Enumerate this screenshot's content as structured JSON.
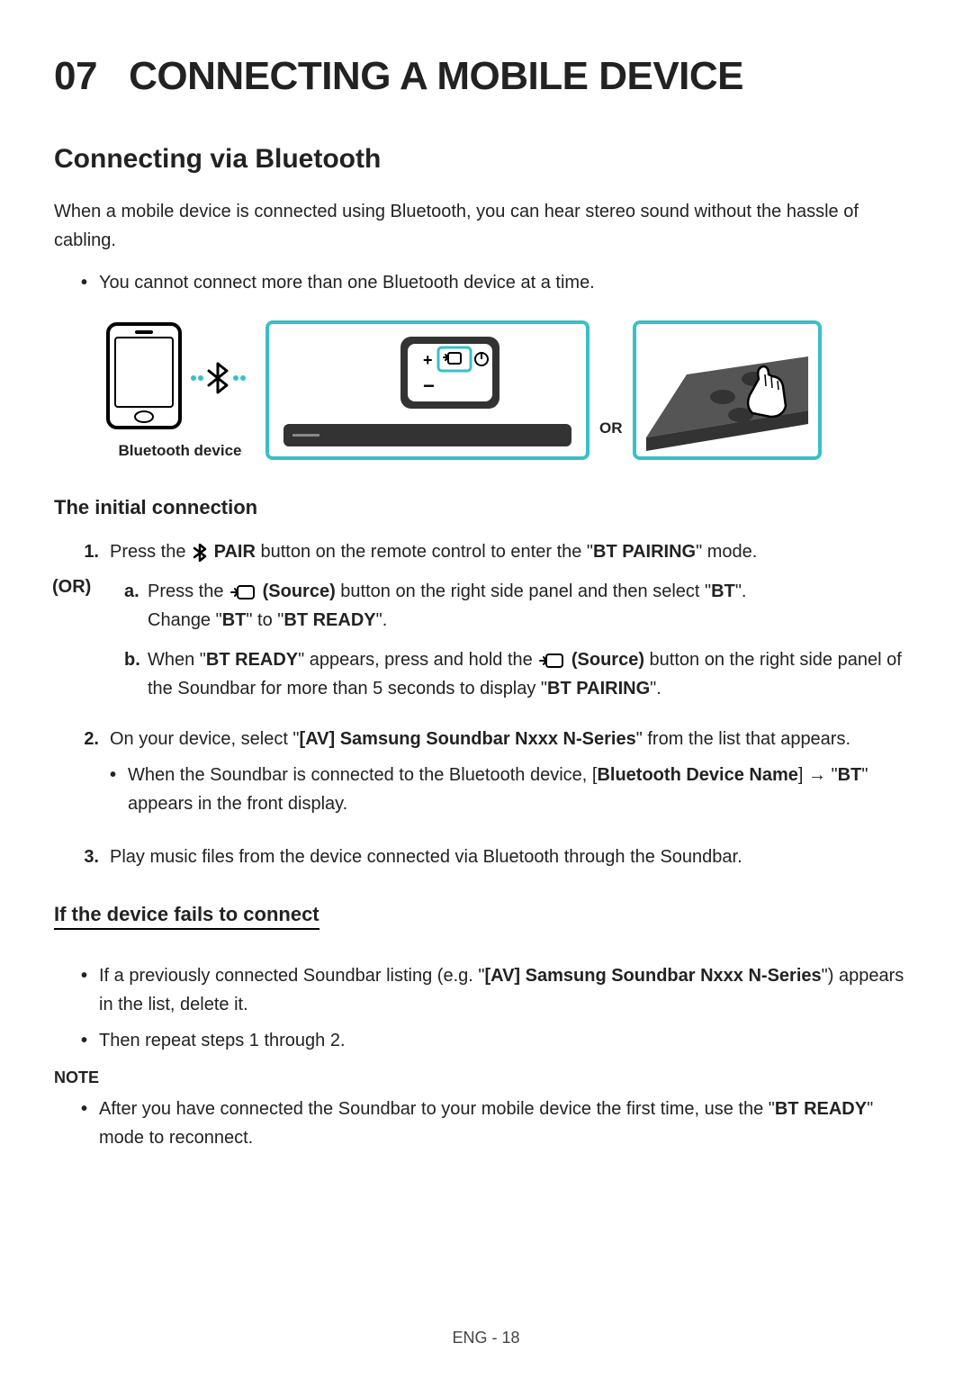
{
  "chapter": {
    "number": "07",
    "title": "CONNECTING A MOBILE DEVICE"
  },
  "section_title": "Connecting via Bluetooth",
  "intro": "When a mobile device is connected using Bluetooth, you can hear stereo sound without the hassle of cabling.",
  "intro_bullet": "You cannot connect more than one Bluetooth device at a time.",
  "figure": {
    "caption": "Bluetooth device",
    "or_label": "OR"
  },
  "sub_initial": "The initial connection",
  "step1": {
    "num": "1.",
    "pre": "Press the ",
    "pair_label": "PAIR",
    "mid": " button on the remote control to enter the \"",
    "bt_pairing": "BT PAIRING",
    "end": "\" mode."
  },
  "or_label": "(OR)",
  "step_a": {
    "letter": "a.",
    "pre": "Press the ",
    "source_label": "(Source)",
    "mid": " button on the right side panel and then select \"",
    "bt": "BT",
    "end": "\".",
    "line2_pre": "Change \"",
    "line2_bt": "BT",
    "line2_mid": "\" to \"",
    "line2_ready": "BT READY",
    "line2_end": "\"."
  },
  "step_b": {
    "letter": "b.",
    "pre": "When \"",
    "bt_ready": "BT READY",
    "mid": "\" appears, press and hold the ",
    "source_label": "(Source)",
    "mid2": " button on the right side panel of the Soundbar for more than 5 seconds to display \"",
    "bt_pairing": "BT PAIRING",
    "end": "\"."
  },
  "step2": {
    "num": "2.",
    "pre": "On your device, select \"",
    "device_name": "[AV] Samsung Soundbar Nxxx N-Series",
    "end": "\" from the list that appears.",
    "bullet_pre": "When the Soundbar is connected to the Bluetooth device, [",
    "bullet_bold": "Bluetooth Device Name",
    "bullet_mid": "] → \"",
    "bullet_bt": "BT",
    "bullet_end": "\" appears in the front display."
  },
  "step3": {
    "num": "3.",
    "text": "Play music files from the device connected via Bluetooth through the Soundbar."
  },
  "sub_fails": "If the device fails to connect",
  "fail_bullet1_pre": "If a previously connected Soundbar listing (e.g. \"",
  "fail_bullet1_bold": "[AV] Samsung Soundbar Nxxx N-Series",
  "fail_bullet1_end": "\") appears in the list, delete it.",
  "fail_bullet2": "Then repeat steps 1 through 2.",
  "note_label": "NOTE",
  "note_bullet_pre": "After you have connected the Soundbar to your mobile device the first time, use the \"",
  "note_bullet_bold": "BT READY",
  "note_bullet_end": "\" mode to reconnect.",
  "footer": "ENG - 18"
}
